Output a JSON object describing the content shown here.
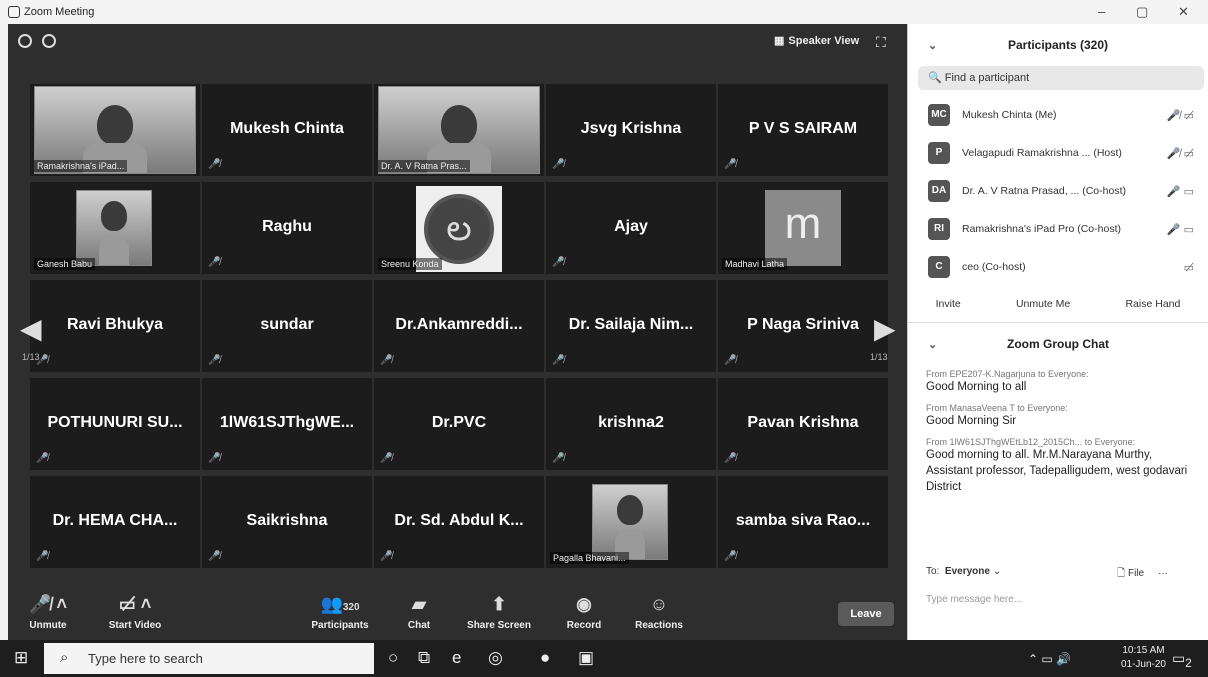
{
  "window": {
    "title": "Zoom Meeting",
    "minimize": "–",
    "restore": "▢",
    "close": "✕"
  },
  "top": {
    "speaker_view": "Speaker View"
  },
  "tiles": [
    {
      "name": "",
      "label": "Ramakrishna's iPad..."
    },
    {
      "name": "Mukesh Chinta",
      "label": ""
    },
    {
      "name": "",
      "label": "Dr. A. V Ratna Pras..."
    },
    {
      "name": "Jsvg Krishna",
      "label": ""
    },
    {
      "name": "P V S SAIRAM",
      "label": ""
    },
    {
      "name": "",
      "label": "Ganesh Babu"
    },
    {
      "name": "Raghu",
      "label": ""
    },
    {
      "name": "",
      "label": "Sreenu Konda"
    },
    {
      "name": "Ajay",
      "label": ""
    },
    {
      "name": "",
      "label": "Madhavi Latha",
      "avatar": "m"
    },
    {
      "name": "Ravi Bhukya",
      "label": ""
    },
    {
      "name": "sundar",
      "label": ""
    },
    {
      "name": "Dr.Ankamreddi...",
      "label": ""
    },
    {
      "name": "Dr. Sailaja Nim...",
      "label": ""
    },
    {
      "name": "P Naga Sriniva",
      "label": ""
    },
    {
      "name": "POTHUNURI SU...",
      "label": ""
    },
    {
      "name": "1lW61SJThgWE...",
      "label": ""
    },
    {
      "name": "Dr.PVC",
      "label": ""
    },
    {
      "name": "krishna2",
      "label": ""
    },
    {
      "name": "Pavan Krishna",
      "label": ""
    },
    {
      "name": "Dr. HEMA CHA...",
      "label": ""
    },
    {
      "name": "Saikrishna",
      "label": ""
    },
    {
      "name": "Dr. Sd. Abdul K...",
      "label": ""
    },
    {
      "name": "",
      "label": "Pagalla Bhavani..."
    },
    {
      "name": "samba siva Rao...",
      "label": ""
    }
  ],
  "pager": {
    "left": "1/13",
    "right": "1/13"
  },
  "toolbar": {
    "unmute": "Unmute",
    "start_video": "Start Video",
    "participants_count": "320",
    "participants": "Participants",
    "chat": "Chat",
    "share_screen": "Share Screen",
    "record": "Record",
    "reactions": "Reactions",
    "leave": "Leave"
  },
  "participants_panel": {
    "title": "Participants (320)",
    "search_placeholder": "Find a participant",
    "list": [
      {
        "initials": "MC",
        "name": "Mukesh Chinta (Me)",
        "icons": "🎤̸ ▭̸"
      },
      {
        "initials": "P",
        "name": "Velagapudi Ramakrishna ... (Host)",
        "icons": "🎤̸ ▭̸"
      },
      {
        "initials": "DA",
        "name": "Dr. A. V Ratna Prasad, ... (Co-host)",
        "icons": "🎤 ▭"
      },
      {
        "initials": "RI",
        "name": "Ramakrishna's iPad Pro (Co-host)",
        "icons": "🎤 ▭"
      },
      {
        "initials": "C",
        "name": "ceo (Co-host)",
        "icons": "▭̸"
      }
    ],
    "invite": "Invite",
    "unmute_me": "Unmute Me",
    "raise_hand": "Raise Hand"
  },
  "chat_panel": {
    "title": "Zoom Group Chat",
    "messages": [
      {
        "from": "From EPE207-K.Nagarjuna to Everyone:",
        "text": "Good Morning to all"
      },
      {
        "from": "From ManasaVeena T to Everyone:",
        "text": "Good Morning Sir"
      },
      {
        "from": "From 1lW61SJThgWEtLb12_2015Ch... to Everyone:",
        "text": "Good morning to all. Mr.M.Narayana Murthy, Assistant professor, Tadepalligudem, west godavari District"
      }
    ],
    "to_label": "To:",
    "to_value": "Everyone",
    "file": "File",
    "more": "···",
    "placeholder": "Type message here..."
  },
  "taskbar": {
    "search": "Type here to search",
    "time": "10:15 AM",
    "date": "01-Jun-20",
    "notif": "2"
  }
}
